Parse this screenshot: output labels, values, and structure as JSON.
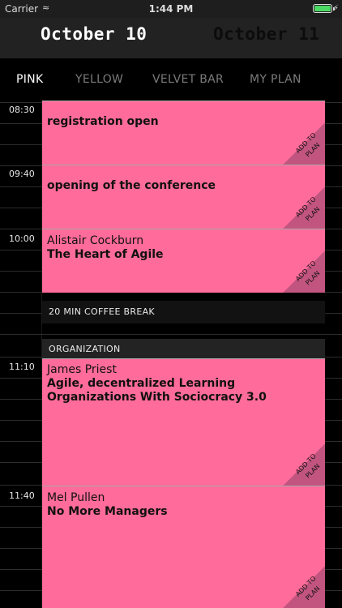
{
  "status_bar": {
    "carrier": "Carrier",
    "time": "1:44 PM",
    "battery_level": 0.95
  },
  "date_tabs": [
    {
      "label": "October 10",
      "active": true
    },
    {
      "label": "October 11",
      "active": false
    }
  ],
  "venue_tabs": [
    {
      "label": "PINK",
      "active": true
    },
    {
      "label": "YELLOW",
      "active": false
    },
    {
      "label": "VELVET BAR",
      "active": false
    },
    {
      "label": "MY PLAN",
      "active": false
    }
  ],
  "schedule": {
    "card_color": "#ff6b9a",
    "add_to_plan_label": "ADD TO PLAN",
    "sessions": [
      {
        "time": "08:30",
        "speaker": "",
        "title": "registration open"
      },
      {
        "time": "09:40",
        "speaker": "",
        "title": "opening of the conference"
      },
      {
        "time": "10:00",
        "speaker": "Alistair Cockburn",
        "title": "The Heart of Agile"
      },
      {
        "time": "11:10",
        "speaker": "James Priest",
        "title": "Agile, decentralized Learning Organizations With Sociocracy 3.0"
      },
      {
        "time": "11:40",
        "speaker": "Mel Pullen",
        "title": "No More Managers"
      }
    ],
    "break_label": "20 MIN COFFEE BREAK",
    "section_label": "ORGANIZATION"
  }
}
